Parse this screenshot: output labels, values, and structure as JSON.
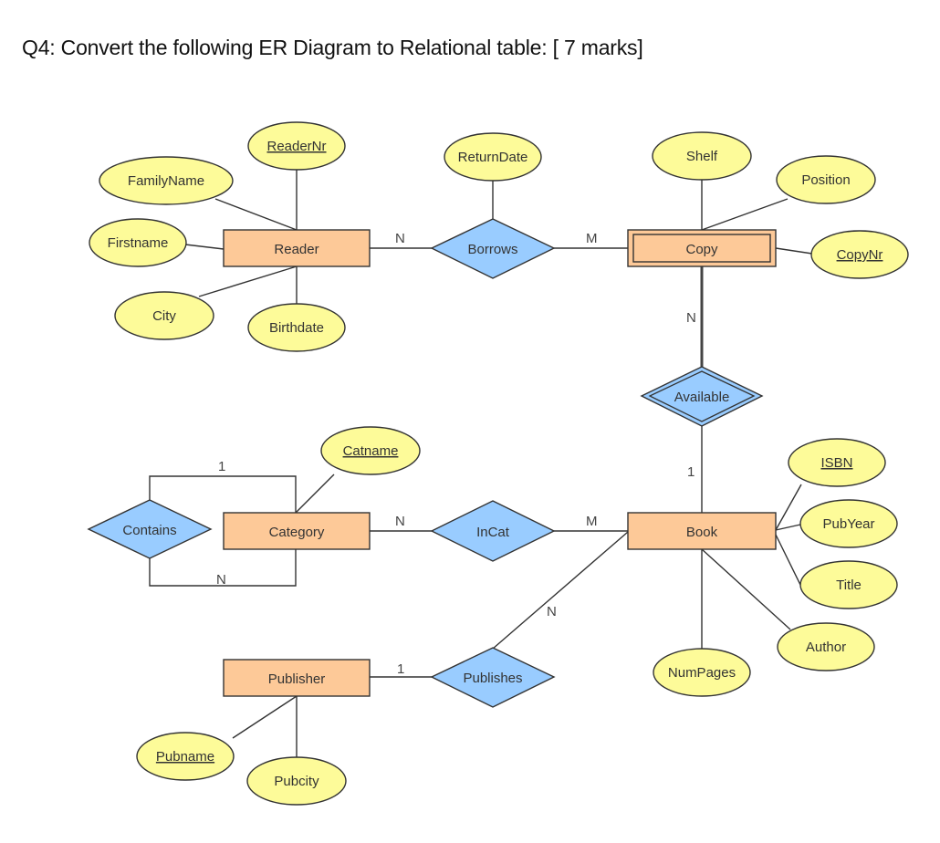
{
  "question": "Q4: Convert the following ER Diagram to Relational table: [ 7 marks]",
  "colors": {
    "entity_fill": "#fdc998",
    "relationship_fill": "#99ccff",
    "attribute_fill": "#fdfb99",
    "stroke": "#333333"
  },
  "entities": [
    {
      "id": "reader",
      "label": "Reader",
      "weak": false
    },
    {
      "id": "copy",
      "label": "Copy",
      "weak": true
    },
    {
      "id": "category",
      "label": "Category",
      "weak": false
    },
    {
      "id": "book",
      "label": "Book",
      "weak": false
    },
    {
      "id": "publisher",
      "label": "Publisher",
      "weak": false
    }
  ],
  "relationships": [
    {
      "id": "borrows",
      "label": "Borrows",
      "identifying": false
    },
    {
      "id": "available",
      "label": "Available",
      "identifying": true
    },
    {
      "id": "contains",
      "label": "Contains",
      "identifying": false
    },
    {
      "id": "incat",
      "label": "InCat",
      "identifying": false
    },
    {
      "id": "publishes",
      "label": "Publishes",
      "identifying": false
    }
  ],
  "attributes": [
    {
      "id": "readernr",
      "label": "ReaderNr",
      "key": true,
      "of": "Reader"
    },
    {
      "id": "familyname",
      "label": "FamilyName",
      "key": false,
      "of": "Reader"
    },
    {
      "id": "firstname",
      "label": "Firstname",
      "key": false,
      "of": "Reader"
    },
    {
      "id": "city",
      "label": "City",
      "key": false,
      "of": "Reader"
    },
    {
      "id": "birthdate",
      "label": "Birthdate",
      "key": false,
      "of": "Reader"
    },
    {
      "id": "returndate",
      "label": "ReturnDate",
      "key": false,
      "of": "Borrows"
    },
    {
      "id": "shelf",
      "label": "Shelf",
      "key": false,
      "of": "Copy"
    },
    {
      "id": "position",
      "label": "Position",
      "key": false,
      "of": "Copy"
    },
    {
      "id": "copynr",
      "label": "CopyNr",
      "key": true,
      "of": "Copy"
    },
    {
      "id": "catname",
      "label": "Catname",
      "key": true,
      "of": "Category"
    },
    {
      "id": "isbn",
      "label": "ISBN",
      "key": true,
      "of": "Book"
    },
    {
      "id": "pubyear",
      "label": "PubYear",
      "key": false,
      "of": "Book"
    },
    {
      "id": "title",
      "label": "Title",
      "key": false,
      "of": "Book"
    },
    {
      "id": "author",
      "label": "Author",
      "key": false,
      "of": "Book"
    },
    {
      "id": "numpages",
      "label": "NumPages",
      "key": false,
      "of": "Book"
    },
    {
      "id": "pubname",
      "label": "Pubname",
      "key": true,
      "of": "Publisher"
    },
    {
      "id": "pubcity",
      "label": "Pubcity",
      "key": false,
      "of": "Publisher"
    }
  ],
  "cardinalities": {
    "reader_borrows": "N",
    "borrows_copy": "M",
    "copy_available": "N",
    "available_book": "1",
    "contains_top": "1",
    "contains_bottom": "N",
    "category_incat": "N",
    "incat_book": "M",
    "publishes_book": "N",
    "publisher_publishes": "1"
  }
}
